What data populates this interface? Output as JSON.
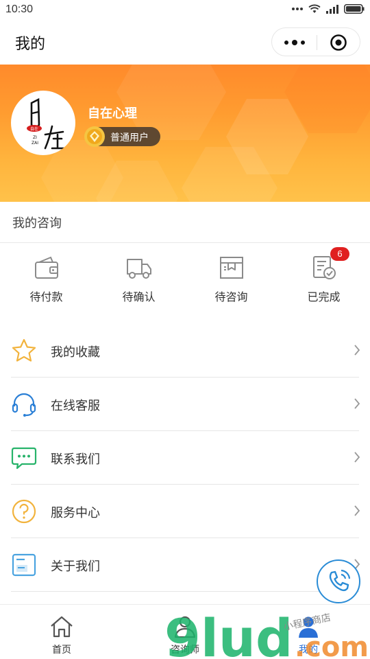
{
  "status_bar": {
    "time": "10:30"
  },
  "title_bar": {
    "title": "我的"
  },
  "profile": {
    "name": "自在心理",
    "badge": "普通用户",
    "banner_colors": [
      "#ff8a2b",
      "#ffc24a"
    ]
  },
  "consult": {
    "title": "我的咨询",
    "orders": [
      {
        "label": "待付款",
        "icon": "wallet-icon"
      },
      {
        "label": "待确认",
        "icon": "truck-icon"
      },
      {
        "label": "待咨询",
        "icon": "box-icon"
      },
      {
        "label": "已完成",
        "icon": "completed-icon",
        "badge": "6"
      }
    ]
  },
  "menu": [
    {
      "label": "我的收藏",
      "icon": "star-icon",
      "color": "#f2b33d"
    },
    {
      "label": "在线客服",
      "icon": "headset-icon",
      "color": "#2a7fd6"
    },
    {
      "label": "联系我们",
      "icon": "chat-bubble-icon",
      "color": "#27b36a"
    },
    {
      "label": "服务中心",
      "icon": "question-icon",
      "color": "#f2b33d"
    },
    {
      "label": "关于我们",
      "icon": "info-card-icon",
      "color": "#4aa3e0"
    }
  ],
  "tab_bar": [
    {
      "label": "首页",
      "icon": "home-icon"
    },
    {
      "label": "咨询师",
      "icon": "counselor-icon"
    },
    {
      "label": "我的",
      "icon": "profile-icon",
      "active": true
    }
  ],
  "watermark": {
    "text": "9lud.com",
    "subtext": "小程序商店"
  }
}
